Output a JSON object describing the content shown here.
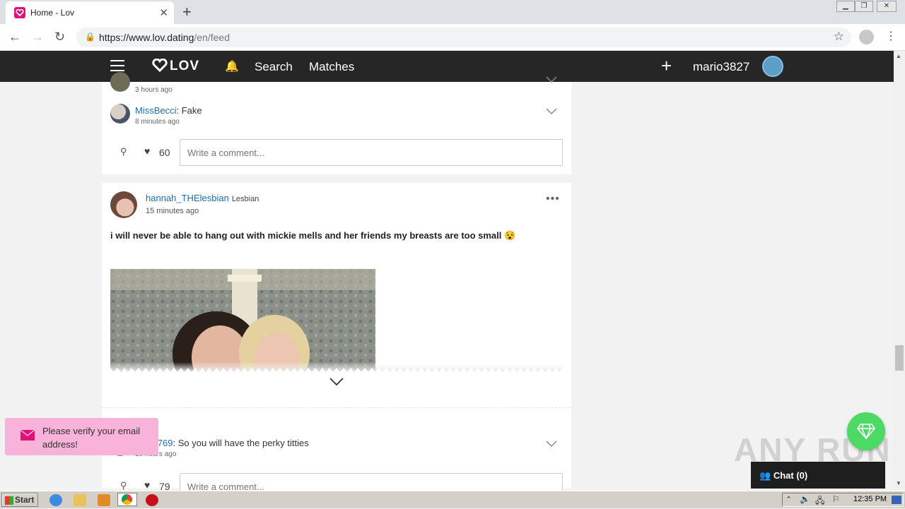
{
  "browser": {
    "tab_title": "Home - Lov",
    "url_host": "https://www.lov.dating",
    "url_path": "/en/feed"
  },
  "header": {
    "logo": "LOV",
    "nav_search": "Search",
    "nav_matches": "Matches",
    "username": "mario3827"
  },
  "top_comments": [
    {
      "user": "",
      "text": "",
      "time": "3 hours ago"
    },
    {
      "user": "MissBecci",
      "text": ": Fake",
      "time": "8 minutes ago"
    }
  ],
  "post1_actions": {
    "likes": "60",
    "comment_placeholder": "Write a comment..."
  },
  "post": {
    "username": "hannah_THElesbian",
    "orientation": "Lesbian",
    "time": "15 minutes ago",
    "text": "i will never be able to hang out with mickie mells and her friends my breasts are too small 😵"
  },
  "post_comment": {
    "user": "beast769",
    "text": ": So you will have the perky titties",
    "time": "10 hours ago"
  },
  "post2_actions": {
    "likes": "79",
    "comment_placeholder": "Write a comment..."
  },
  "toast": {
    "message": "Please verify your email address!"
  },
  "chat": {
    "label": "Chat (0)"
  },
  "watermark": "ANY RUN",
  "taskbar": {
    "start": "Start",
    "clock": "12:35 PM"
  },
  "colors": {
    "brand": "#e0117a",
    "link": "#1f6fa8",
    "header_bg": "#262626",
    "toast_bg": "#f7b3d9",
    "gem": "#4cd964"
  }
}
